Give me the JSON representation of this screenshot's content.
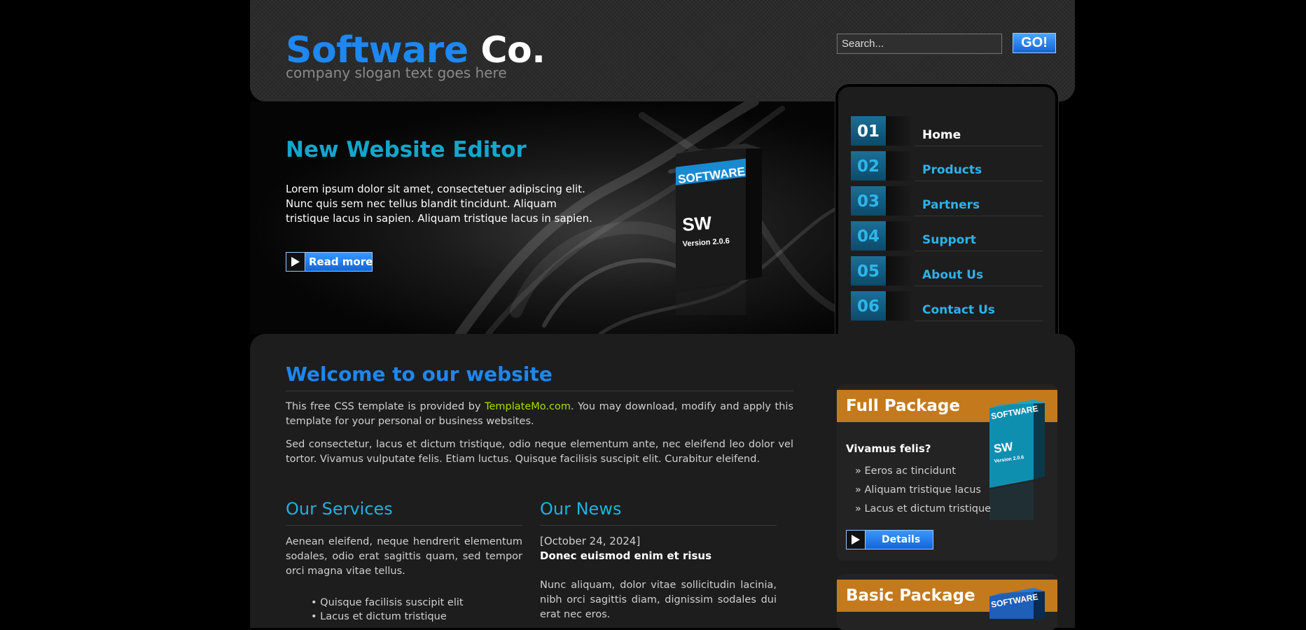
{
  "header": {
    "logo_part1": "Software",
    "logo_part2": "Co.",
    "slogan": "company slogan text goes here",
    "search_placeholder": "Search...",
    "go_label": "GO!"
  },
  "banner": {
    "title": "New Website Editor",
    "text": "Lorem ipsum dolor sit amet, consectetuer adipiscing elit. Nunc quis sem nec tellus blandit tincidunt. Aliquam tristique lacus in sapien. Aliquam tristique lacus in sapien.",
    "read_more": "Read more",
    "box_brand": "SOFTWARE",
    "box_model": "SW",
    "box_version": "Version 2.0.6"
  },
  "nav": {
    "items": [
      {
        "num": "01",
        "label": "Home",
        "active": true
      },
      {
        "num": "02",
        "label": "Products"
      },
      {
        "num": "03",
        "label": "Partners"
      },
      {
        "num": "04",
        "label": "Support"
      },
      {
        "num": "05",
        "label": "About Us"
      },
      {
        "num": "06",
        "label": "Contact Us"
      }
    ]
  },
  "welcome": {
    "title": "Welcome to our website",
    "p1_before": "This free CSS template is provided by ",
    "p1_link": "TemplateMo.com",
    "p1_after": ". You may download, modify and apply this template for your personal or business websites.",
    "p2": "Sed consectetur, lacus et dictum tristique, odio neque elementum ante, nec eleifend leo dolor vel tortor. Vivamus vulputate felis. Etiam luctus. Quisque facilisis suscipit elit. Curabitur eleifend."
  },
  "services": {
    "title": "Our Services",
    "text": "Aenean eleifend, neque hendrerit elementum sodales, odio erat sagittis quam, sed tempor orci magna vitae tellus.",
    "items": [
      "Quisque facilisis suscipit elit",
      "Lacus et dictum tristique"
    ]
  },
  "news": {
    "title": "Our News",
    "date": "[October 24, 2024]",
    "headline": "Donec euismod enim et risus",
    "text": "Nunc aliquam, dolor vitae sollicitudin lacinia, nibh orci sagittis diam, dignissim sodales dui erat nec eros."
  },
  "packages": [
    {
      "title": "Full Package",
      "subtitle": "Vivamus felis?",
      "items": [
        "» Eeros ac tincidunt",
        "» Aliquam tristique lacus",
        "» Lacus et dictum tristique"
      ],
      "button": "Details",
      "box_brand": "SOFTWARE",
      "box_model": "SW",
      "box_version": "Version 2.0.6"
    },
    {
      "title": "Basic Package",
      "box_brand": "SOFTWARE"
    }
  ],
  "colors": {
    "brand_blue": "#1e87f0",
    "section_cyan": "#1eb2e0",
    "nav_cyan": "#2fb2ea",
    "link_green": "#aadd00",
    "package_orange": "#c47a1c"
  }
}
